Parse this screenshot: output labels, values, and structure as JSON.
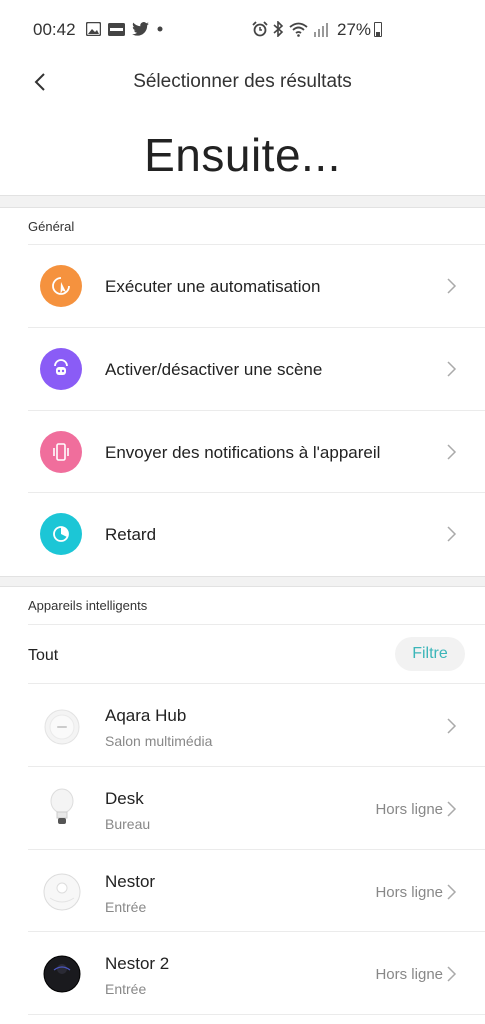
{
  "status_bar": {
    "time": "00:42",
    "left_icons": [
      "image-icon",
      "news-icon",
      "twitter-icon",
      "dot-icon"
    ],
    "right_icons": [
      "alarm-icon",
      "bluetooth-icon",
      "wifi-icon",
      "signal-icon"
    ],
    "battery": "27%"
  },
  "header": {
    "title": "Sélectionner des résultats",
    "back_icon": "back-arrow-icon"
  },
  "big_title": "Ensuite...",
  "general": {
    "label": "Général",
    "items": [
      {
        "label": "Exécuter une automatisation",
        "icon": "automation-icon",
        "color": "#f5923e"
      },
      {
        "label": "Activer/désactiver une scène",
        "icon": "scene-icon",
        "color": "#8a5cf6"
      },
      {
        "label": "Envoyer des notifications à l'appareil",
        "icon": "phone-vibrate-icon",
        "color": "#f06e9c"
      },
      {
        "label": "Retard",
        "icon": "timer-icon",
        "color": "#1cc6d6"
      }
    ]
  },
  "devices": {
    "label": "Appareils intelligents",
    "filter_all": "Tout",
    "filter_button": "Filtre",
    "items": [
      {
        "name": "Aqara Hub",
        "room": "Salon multimédia",
        "status": "",
        "icon": "hub-device-icon"
      },
      {
        "name": "Desk",
        "room": "Bureau",
        "status": "Hors ligne",
        "icon": "bulb-device-icon"
      },
      {
        "name": "Nestor",
        "room": "Entrée",
        "status": "Hors ligne",
        "icon": "robot-vacuum-white-icon"
      },
      {
        "name": "Nestor 2",
        "room": "Entrée",
        "status": "Hors ligne",
        "icon": "robot-vacuum-black-icon"
      }
    ]
  },
  "colors": {
    "accent": "#3bb6b9",
    "section_bg": "#f2f2f2"
  }
}
